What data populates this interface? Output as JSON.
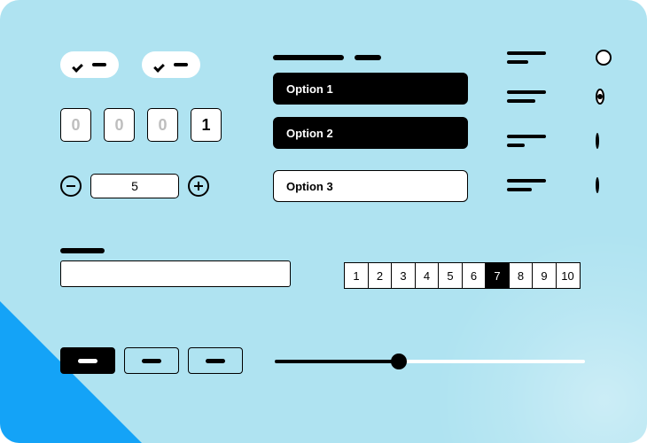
{
  "chips": [
    {
      "checked": true
    },
    {
      "checked": true
    }
  ],
  "otp": {
    "digits": [
      "0",
      "0",
      "0",
      "1"
    ],
    "filled_index": 3
  },
  "stepper": {
    "value": "5"
  },
  "options": [
    {
      "label": "Option 1",
      "variant": "dark"
    },
    {
      "label": "Option 2",
      "variant": "dark"
    },
    {
      "label": "Option 3",
      "variant": "light"
    }
  ],
  "radio_groups": {
    "items": [
      {
        "selected": false
      },
      {
        "selected": true
      },
      {
        "selected": false
      },
      {
        "selected": false
      }
    ]
  },
  "pagination": {
    "pages": [
      "1",
      "2",
      "3",
      "4",
      "5",
      "6",
      "7",
      "8",
      "9",
      "10"
    ],
    "active": "7"
  },
  "slider": {
    "percent": 40
  }
}
